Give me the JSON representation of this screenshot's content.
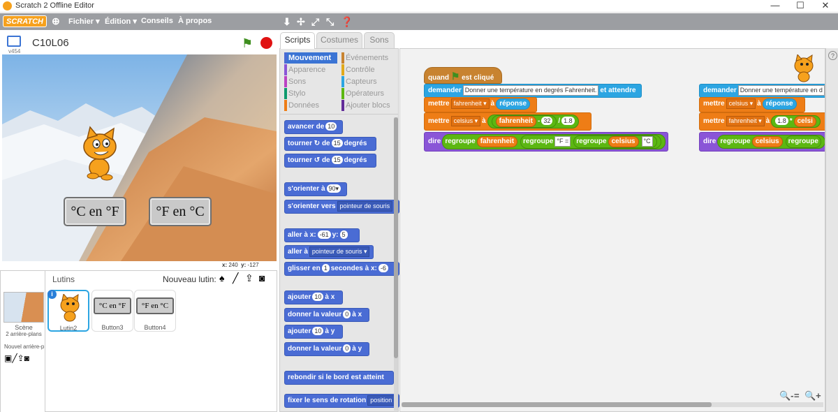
{
  "window": {
    "title": "Scratch 2 Offline Editor",
    "minimize": "—",
    "maximize": "☐",
    "close": "✕"
  },
  "menubar": {
    "logo": "SCRATCH",
    "items": [
      "Fichier ▾",
      "Édition ▾",
      "Conseils",
      "À propos"
    ],
    "tool_icons": [
      "duplicate-icon",
      "cut-icon",
      "grow-icon",
      "shrink-icon",
      "help-icon"
    ]
  },
  "stage": {
    "version": "v454",
    "project_title": "C10L06",
    "coords_x_label": "x:",
    "coords_x": "240",
    "coords_y_label": "y:",
    "coords_y": "-127",
    "buttons": [
      "°C en °F",
      "°F en °C"
    ]
  },
  "sprites": {
    "header": "Lutins",
    "new_sprite_label": "Nouveau lutin:",
    "scene_label": "Scène",
    "scene_sub": "2 arrière-plans",
    "new_backdrop_label": "Nouvel arrière-p",
    "list": [
      {
        "name": "Lutin2",
        "selected": true
      },
      {
        "name": "Button3",
        "thumb": "°C en °F"
      },
      {
        "name": "Button4",
        "thumb": "°F en °C"
      }
    ]
  },
  "tabs": [
    "Scripts",
    "Costumes",
    "Sons"
  ],
  "categories": {
    "left": [
      {
        "label": "Mouvement",
        "color": "#4a6cd4",
        "selected": true
      },
      {
        "label": "Apparence",
        "color": "#8a55d7"
      },
      {
        "label": "Sons",
        "color": "#bb42c3"
      },
      {
        "label": "Stylo",
        "color": "#0e9a6c"
      },
      {
        "label": "Données",
        "color": "#ee7d16"
      }
    ],
    "right": [
      {
        "label": "Événements",
        "color": "#c88330"
      },
      {
        "label": "Contrôle",
        "color": "#e1a91a"
      },
      {
        "label": "Capteurs",
        "color": "#2ca5e2"
      },
      {
        "label": "Opérateurs",
        "color": "#5cb712"
      },
      {
        "label": "Ajouter blocs",
        "color": "#632d99"
      }
    ]
  },
  "palette": {
    "b1": {
      "a": "avancer de",
      "v": "10"
    },
    "b2": {
      "a": "tourner",
      "icon": "↻",
      "b": "de",
      "v": "15",
      "c": "degrés"
    },
    "b3": {
      "a": "tourner",
      "icon": "↺",
      "b": "de",
      "v": "15",
      "c": "degrés"
    },
    "b4": {
      "a": "s'orienter à",
      "v": "90▾"
    },
    "b5": {
      "a": "s'orienter vers",
      "v": "pointeur de souris"
    },
    "b6": {
      "a": "aller à x:",
      "x": "-61",
      "b": "y:",
      "y": "5"
    },
    "b7": {
      "a": "aller à",
      "v": "pointeur de souris ▾"
    },
    "b8": {
      "a": "glisser en",
      "v": "1",
      "b": "secondes à x:",
      "x": "-6"
    },
    "b9": {
      "a": "ajouter",
      "v": "10",
      "b": "à x"
    },
    "b10": {
      "a": "donner la valeur",
      "v": "0",
      "b": "à x"
    },
    "b11": {
      "a": "ajouter",
      "v": "10",
      "b": "à y"
    },
    "b12": {
      "a": "donner la valeur",
      "v": "0",
      "b": "à y"
    },
    "b13": {
      "a": "rebondir si le bord est atteint"
    },
    "b14": {
      "a": "fixer le sens de rotation",
      "v": "position"
    }
  },
  "script1": {
    "hat": {
      "a": "quand",
      "b": "est cliqué"
    },
    "ask": {
      "a": "demander",
      "v": "Donner une température en degrés Fahrenheit.",
      "b": "et attendre"
    },
    "set1": {
      "a": "mettre",
      "var": "fahrenheit ▾",
      "b": "à",
      "v": "réponse"
    },
    "set2": {
      "a": "mettre",
      "var": "celsius ▾",
      "b": "à",
      "v1": "fahrenheit",
      "op1": "-",
      "n1": "32",
      "op2": "/",
      "n2": "1.8"
    },
    "say": {
      "a": "dire",
      "j1": "regroupe",
      "v1": "fahrenheit",
      "j2": "regroupe",
      "t1": "°F =",
      "j3": "regroupe",
      "v2": "celsius",
      "t2": "°C"
    }
  },
  "script2": {
    "ask": {
      "a": "demander",
      "v": "Donner une température en d"
    },
    "set1": {
      "a": "mettre",
      "var": "celsius ▾",
      "b": "à",
      "v": "réponse"
    },
    "set2": {
      "a": "mettre",
      "var": "fahrenheit ▾",
      "b": "à",
      "n1": "1.8",
      "op1": "*",
      "v1": "celsi"
    },
    "say": {
      "a": "dire",
      "j1": "regroupe",
      "v1": "celsius",
      "j2": "regroupe"
    }
  },
  "zoom": {
    "out": "🔍-",
    "reset": "=",
    "in": "🔍+"
  }
}
